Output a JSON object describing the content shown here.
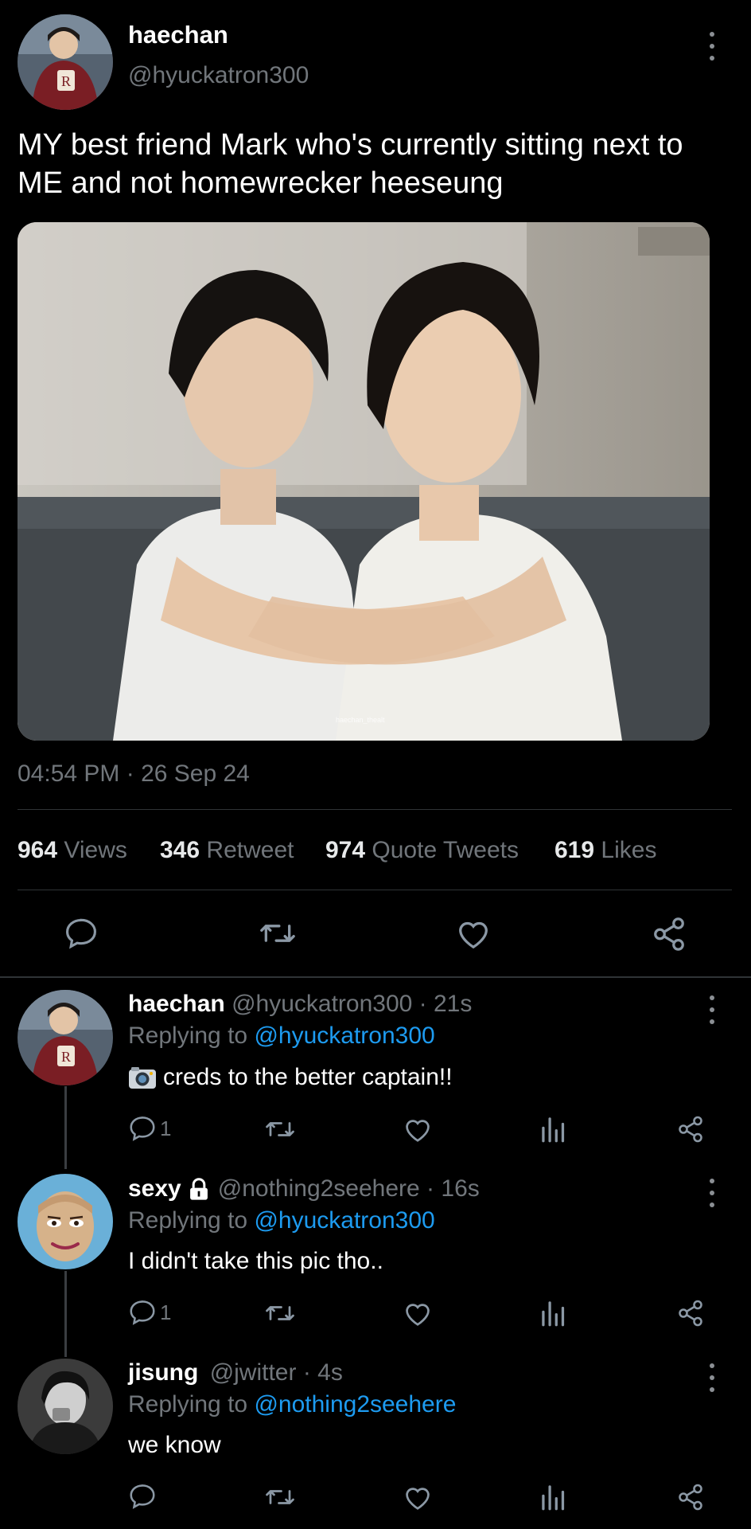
{
  "tweet": {
    "display_name": "haechan",
    "handle": "@hyuckatron300",
    "text_line1": "MY best friend Mark who's currently sitting next to",
    "text_line2": "ME and not homewrecker heeseung",
    "image_watermark": "haechan_thealt",
    "timestamp": "04:54 PM · 26 Sep 24",
    "stats": {
      "views_count": "964",
      "views_label": "Views",
      "retweet_count": "346",
      "retweet_label": "Retweet",
      "quote_count": "974",
      "quote_label": "Quote Tweets",
      "likes_count": "619",
      "likes_label": "Likes"
    }
  },
  "replies": [
    {
      "display_name": "haechan",
      "handle_time": "@hyuckatron300 · 21s",
      "replying_prefix": "Replying to",
      "replying_to": "@hyuckatron300",
      "text": "creds to the better captain!!",
      "reply_count": "1"
    },
    {
      "display_name": "sexy",
      "handle_time": "@nothing2seehere · 16s",
      "replying_prefix": "Replying to",
      "replying_to": "@hyuckatron300",
      "text": "I didn't take this pic tho..",
      "reply_count": "1"
    },
    {
      "display_name": "jisung",
      "handle_time": "@jwitter · 4s",
      "replying_prefix": "Replying to",
      "replying_to": "@nothing2seehere",
      "text": "we know",
      "reply_count": ""
    }
  ],
  "icons": {
    "more": "more-vertical-icon",
    "reply": "reply-bubble-icon",
    "retweet": "retweet-icon",
    "like": "heart-icon",
    "share": "share-icon",
    "analytics": "analytics-bars-icon",
    "camera": "camera-emoji-icon",
    "lock": "lock-icon"
  },
  "colors": {
    "background": "#000000",
    "text": "#e7e9ea",
    "muted": "#71767b",
    "accent": "#1d9bf0",
    "divider": "#2f3336"
  }
}
